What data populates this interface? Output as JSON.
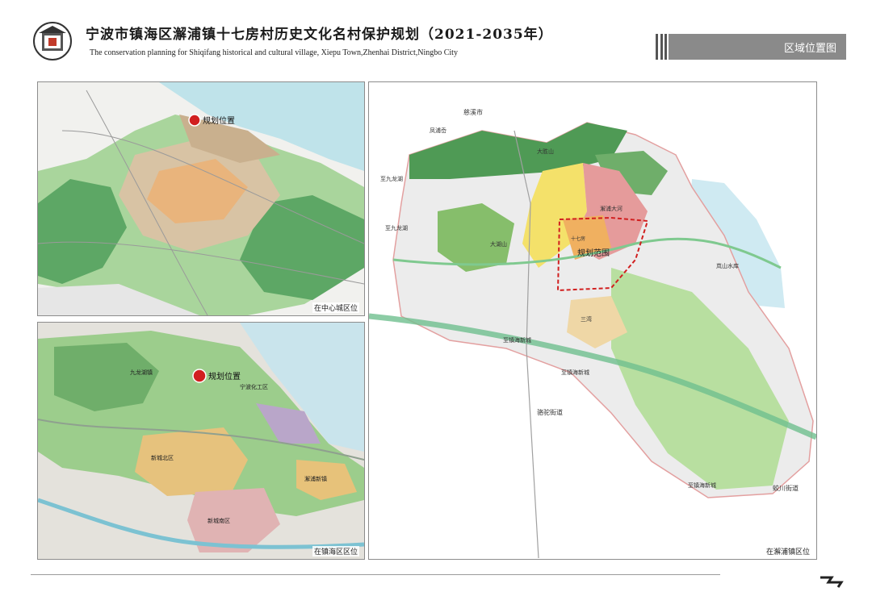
{
  "header": {
    "title_cn": "宁波市镇海区澥浦镇十七房村历史文化名村保护规划（2021-2035年）",
    "title_en": "The conservation planning for Shiqifang historical and cultural village, Xiepu Town,Zhenhai District,Ningbo City",
    "section_tag": "区域位置图"
  },
  "panels": {
    "city": {
      "caption": "在中心城区位",
      "marker_label": "规划位置"
    },
    "district": {
      "caption": "在镇海区区位",
      "marker_label": "规划位置",
      "labels": [
        "九龙湖镇",
        "宁波化工区",
        "新城北区",
        "澥浦新镇",
        "新城南区"
      ]
    },
    "town": {
      "caption": "在澥浦镇区位",
      "boundary_label": "规划范围",
      "labels": [
        "慈溪市",
        "凤浦岙",
        "至九龙湖",
        "至九龙湖",
        "骆驼街道",
        "蛟川街道",
        "至镇海新城",
        "至镇海新城",
        "至镇海新城",
        "岚山水库",
        "澥浦大河",
        "大湖山",
        "大胜山",
        "十七房",
        "三湾"
      ]
    }
  },
  "colors": {
    "water": "#bfe3ea",
    "green": "#7fc07a",
    "dark_green": "#4f9a55",
    "residential": "#f2c96a",
    "commercial": "#e7898b",
    "industrial": "#c0a0c8",
    "boundary": "#d11f1f",
    "tag_bg": "#8a8a8a"
  },
  "icons": [
    "logo-emblem-icon",
    "location-pin-icon"
  ]
}
